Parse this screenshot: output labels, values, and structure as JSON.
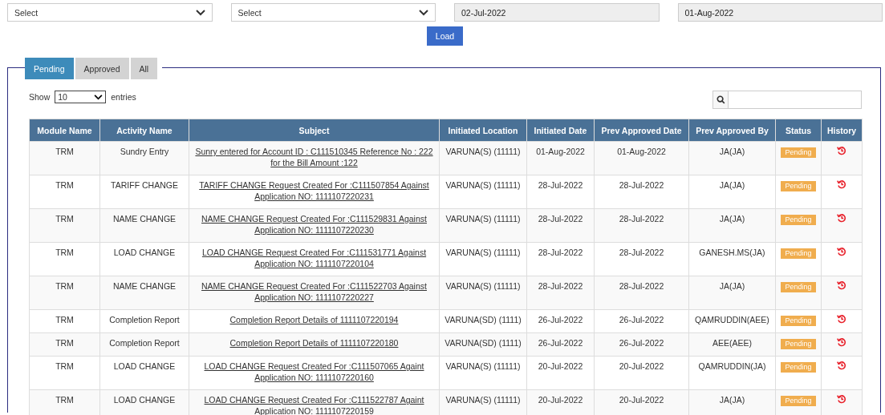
{
  "filters": {
    "select_1": "Select",
    "select_2": "Select",
    "from_date": "02-Jul-2022",
    "to_date": "01-Aug-2022",
    "load_button": "Load"
  },
  "tabs": [
    {
      "label": "Pending",
      "selected": true
    },
    {
      "label": "Approved",
      "selected": false
    },
    {
      "label": "All",
      "selected": false
    }
  ],
  "length_menu": {
    "before": "Show",
    "value": "10",
    "after": "entries"
  },
  "table": {
    "columns": [
      "Module Name",
      "Activity Name",
      "Subject",
      "Initiated Location",
      "Initiated Date",
      "Prev Approved Date",
      "Prev Approved By",
      "Status",
      "History"
    ],
    "rows": [
      {
        "module": "TRM",
        "activity": "Sundry Entry",
        "subject": "Sunry entered for Account ID : C111510345 Reference No : 222 for the Bill Amount :122",
        "location": "VARUNA(S) (11111)",
        "initiated_date": "01-Aug-2022",
        "prev_date": "01-Aug-2022",
        "prev_by": "JA(JA)",
        "status": "Pending"
      },
      {
        "module": "TRM",
        "activity": "TARIFF CHANGE",
        "subject": "TARIFF CHANGE Request Created For :C111507854 Against Application NO: 1111107220231",
        "location": "VARUNA(S) (11111)",
        "initiated_date": "28-Jul-2022",
        "prev_date": "28-Jul-2022",
        "prev_by": "JA(JA)",
        "status": "Pending"
      },
      {
        "module": "TRM",
        "activity": "NAME CHANGE",
        "subject": "NAME CHANGE Request Created For :C111529831 Against Application NO: 1111107220230",
        "location": "VARUNA(S) (11111)",
        "initiated_date": "28-Jul-2022",
        "prev_date": "28-Jul-2022",
        "prev_by": "JA(JA)",
        "status": "Pending"
      },
      {
        "module": "TRM",
        "activity": "LOAD CHANGE",
        "subject": "LOAD CHANGE Request Created For :C111531771 Against Application NO: 1111107220104",
        "location": "VARUNA(S) (11111)",
        "initiated_date": "28-Jul-2022",
        "prev_date": "28-Jul-2022",
        "prev_by": "GANESH.MS(JA)",
        "status": "Pending"
      },
      {
        "module": "TRM",
        "activity": "NAME CHANGE",
        "subject": "NAME CHANGE Request Created For :C111522703 Against Application NO: 1111107220227",
        "location": "VARUNA(S) (11111)",
        "initiated_date": "28-Jul-2022",
        "prev_date": "28-Jul-2022",
        "prev_by": "JA(JA)",
        "status": "Pending"
      },
      {
        "module": "TRM",
        "activity": "Completion Report",
        "subject": "Completion Report Details of 1111107220194",
        "location": "VARUNA(SD) (1111)",
        "initiated_date": "26-Jul-2022",
        "prev_date": "26-Jul-2022",
        "prev_by": "QAMRUDDIN(AEE)",
        "status": "Pending"
      },
      {
        "module": "TRM",
        "activity": "Completion Report",
        "subject": "Completion Report Details of 1111107220180",
        "location": "VARUNA(SD) (1111)",
        "initiated_date": "26-Jul-2022",
        "prev_date": "26-Jul-2022",
        "prev_by": "AEE(AEE)",
        "status": "Pending"
      },
      {
        "module": "TRM",
        "activity": "LOAD CHANGE",
        "subject": "LOAD CHANGE Request Created For :C111507065 Againt Application NO: 1111107220160",
        "location": "VARUNA(S) (11111)",
        "initiated_date": "20-Jul-2022",
        "prev_date": "20-Jul-2022",
        "prev_by": "QAMRUDDIN(JA)",
        "status": "Pending"
      },
      {
        "module": "TRM",
        "activity": "LOAD CHANGE",
        "subject": "LOAD CHANGE Request Created For :C111522787 Againt Application NO: 1111107220159",
        "location": "VARUNA(S) (11111)",
        "initiated_date": "20-Jul-2022",
        "prev_date": "20-Jul-2022",
        "prev_by": "JA(JA)",
        "status": "Pending"
      }
    ]
  }
}
